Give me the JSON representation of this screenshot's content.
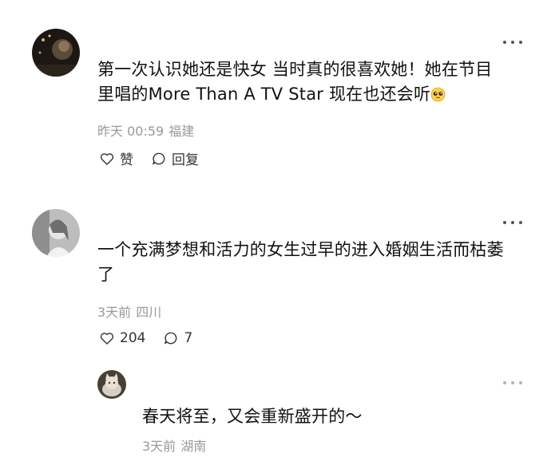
{
  "comments": [
    {
      "text_line1": "第一次认识她还是快女 当时真的很喜欢她！她在节目",
      "text_line2": "里唱的More Than A TV Star 现在也还会听",
      "time": "昨天 00:59",
      "location": "福建",
      "like_label": "赞",
      "reply_label": "回复",
      "avatar_icon": "avatar-dark-concert",
      "emoji_icon": "pleading-face-emoji"
    },
    {
      "text_line1": "一个充满梦想和活力的女生过早的进入婚姻生活而枯萎",
      "text_line2": "了",
      "time": "3天前",
      "location": "四川",
      "like_count": "204",
      "reply_count": "7",
      "avatar_icon": "avatar-grayscale-portrait"
    }
  ],
  "reply": {
    "text": "春天将至，又会重新盛开的～",
    "time": "3天前",
    "location": "湖南",
    "avatar_icon": "avatar-cat"
  },
  "colors": {
    "text": "#111111",
    "meta": "#999999",
    "icon": "#333333"
  }
}
